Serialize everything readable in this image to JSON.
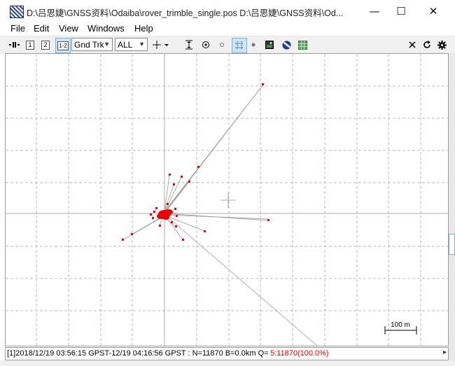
{
  "window": {
    "title": "D:\\吕思婕\\GNSS资料\\Odaiba\\rover_trimble_single.pos D:\\吕思婕\\GNSS资料\\Od...",
    "minimize_glyph": "—",
    "maximize_glyph": "☐",
    "close_glyph": "✕"
  },
  "menu": {
    "items": [
      "File",
      "Edit",
      "View",
      "Windows",
      "Help"
    ]
  },
  "toolbar": {
    "btn1": "1",
    "btn2": "2",
    "btn12": "1-2",
    "plot_type": "Gnd Trk",
    "quality": "ALL",
    "icons": [
      "play-icon",
      "crosshair-icon",
      "fit-height-icon",
      "center-icon",
      "small-dot-icon",
      "grid-icon",
      "dot-icon",
      "image-icon",
      "globe-icon",
      "map-icon",
      "close-icon",
      "reload-icon",
      "gear-icon"
    ]
  },
  "plot": {
    "scale_label": "100 m",
    "point_color": "#ee0000",
    "line_color": "#9a9a9a",
    "grid_color": "#b8b8b8"
  },
  "status": {
    "text": "[1]2018/12/19 03:56:15 GPST-12/19 04:16:56 GPST : N=11870 B=0.0km Q=",
    "quality": "5:11870(100.0%)"
  }
}
